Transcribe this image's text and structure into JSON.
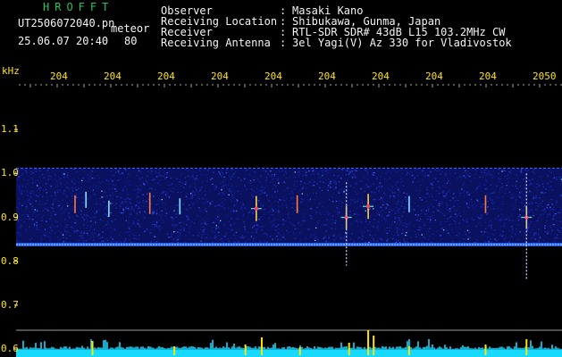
{
  "header": {
    "app_title": "HROFFT",
    "file_name": "UT2506072040.pn",
    "mode": "meteor",
    "datetime": "25.06.07 20:40",
    "gain": "80",
    "fields": [
      {
        "label": "Observer",
        "value": "Masaki Kano"
      },
      {
        "label": "Receiving Location",
        "value": "Shibukawa, Gunma, Japan"
      },
      {
        "label": "Receiver",
        "value": "RTL-SDR SDR# 43dB L15 103.2MHz CW"
      },
      {
        "label": "Receiving Antenna",
        "value": "3el Yagi(V) Az 330 for Vladivostok"
      }
    ],
    "separator": ":"
  },
  "time_axis": {
    "labels": [
      "204",
      "204",
      "204",
      "204",
      "204",
      "204",
      "204",
      "204",
      "204",
      "2050"
    ]
  },
  "freq_axis": {
    "unit": "kHz",
    "ticks": [
      {
        "label": "1.1",
        "value": 1.1
      },
      {
        "label": "1.0",
        "value": 1.0
      },
      {
        "label": "0.9",
        "value": 0.9
      },
      {
        "label": "0.8",
        "value": 0.8
      },
      {
        "label": "0.7",
        "value": 0.7
      },
      {
        "label": "0.6",
        "value": 0.6
      }
    ],
    "range": [
      0.59,
      1.2
    ]
  },
  "spectrogram": {
    "band_top_khz": 1.012,
    "band_bottom_khz": 0.835,
    "carrier_khz": 0.838,
    "upper_line_khz": 1.012,
    "meteors": [
      {
        "t": 0.108,
        "f": 0.93,
        "strength": 0.6
      },
      {
        "t": 0.128,
        "f": 0.94,
        "strength": 0.5
      },
      {
        "t": 0.17,
        "f": 0.92,
        "strength": 0.5
      },
      {
        "t": 0.245,
        "f": 0.932,
        "strength": 0.8
      },
      {
        "t": 0.3,
        "f": 0.925,
        "strength": 0.5
      },
      {
        "t": 0.44,
        "f": 0.92,
        "strength": 1.0
      },
      {
        "t": 0.515,
        "f": 0.93,
        "strength": 0.6
      },
      {
        "t": 0.605,
        "f": 0.9,
        "strength": 0.9
      },
      {
        "t": 0.645,
        "f": 0.925,
        "strength": 1.0
      },
      {
        "t": 0.72,
        "f": 0.93,
        "strength": 0.5
      },
      {
        "t": 0.86,
        "f": 0.93,
        "strength": 0.6
      },
      {
        "t": 0.935,
        "f": 0.9,
        "strength": 0.9
      }
    ]
  },
  "colors": {
    "background": "#000000",
    "title_green": "#22c55e",
    "text_white": "#f4f4f4",
    "label_yellow": "#ffe600",
    "level_cyan": "#17d8ff",
    "level_yellow": "#ffe600",
    "band_blue": "#1a2aa8"
  }
}
